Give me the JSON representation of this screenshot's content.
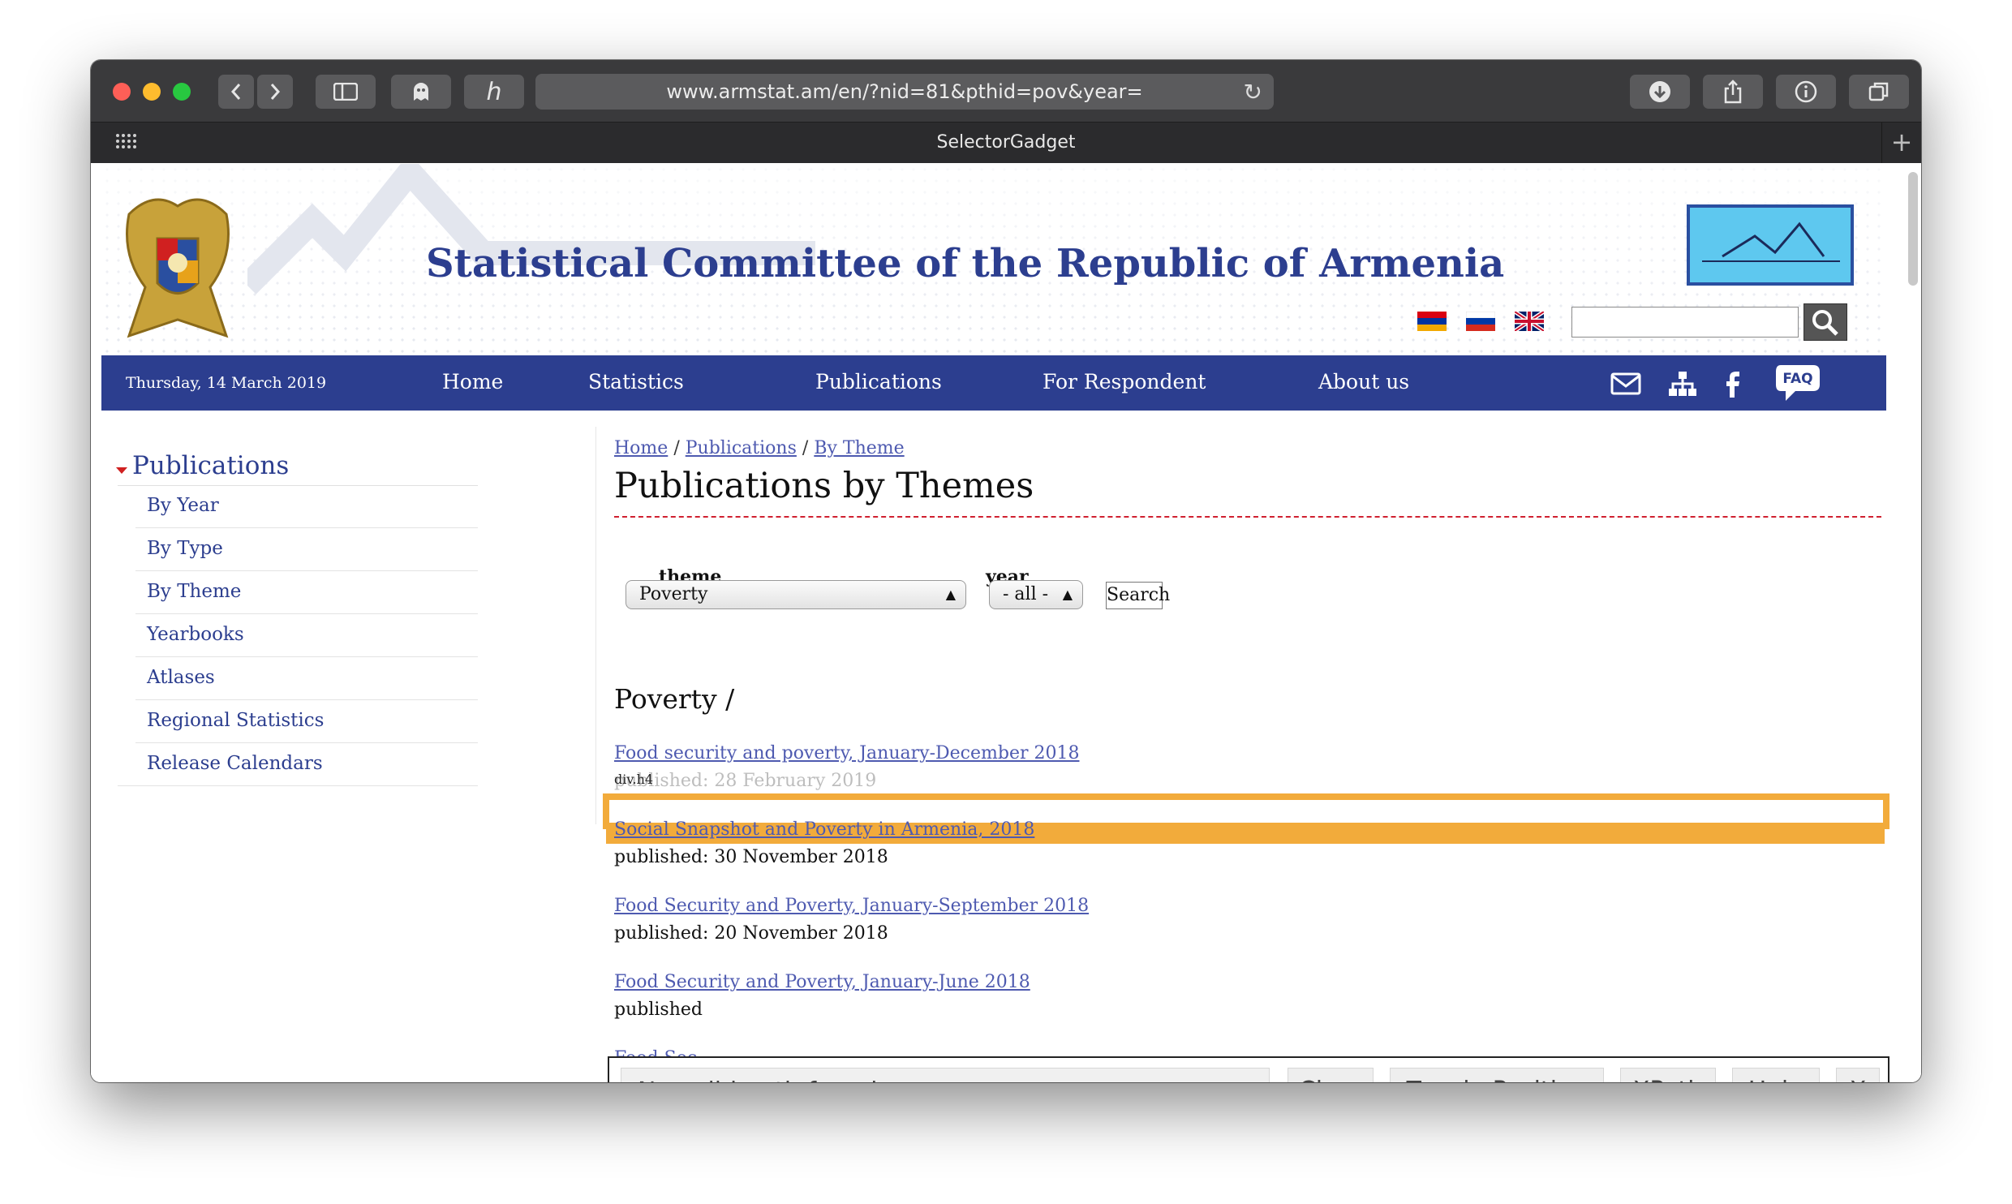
{
  "browser": {
    "url": "www.armstat.am/en/?nid=81&pthid=pov&year=",
    "tab_title": "SelectorGadget"
  },
  "site": {
    "title": "Statistical Committee of the Republic of Armenia",
    "nav": {
      "date": "Thursday, 14 March 2019",
      "items": [
        "Home",
        "Statistics",
        "Publications",
        "For Respondent",
        "About us"
      ],
      "faq": "FAQ"
    },
    "sidebar": {
      "heading": "Publications",
      "items": [
        "By Year",
        "By Type",
        "By Theme",
        "Yearbooks",
        "Atlases",
        "Regional Statistics",
        "Release Calendars"
      ]
    },
    "breadcrumb": {
      "items": [
        "Home",
        "Publications",
        "By Theme"
      ],
      "separator": "/"
    },
    "page_title": "Publications by Themes",
    "filters": {
      "theme_label": "theme",
      "theme_value": "Poverty",
      "year_label": "year",
      "year_value": "- all -",
      "search_label": "Search"
    },
    "section_title": "Poverty /",
    "publications": [
      {
        "title": "Food security and poverty, January-December 2018",
        "date": "published: 28 February 2019"
      },
      {
        "title": "Social Snapshot and Poverty in Armenia, 2018",
        "date": "published: 30 November 2018"
      },
      {
        "title": "Food Security and Poverty, January-September 2018",
        "date": "published: 20 November 2018"
      },
      {
        "title": "Food Security and Poverty, January-June 2018",
        "date": "published"
      },
      {
        "title": "Food Sec",
        "date": ""
      }
    ],
    "highlight_label": "div.h4"
  },
  "selector_gadget": {
    "status": "No valid path found.",
    "buttons": [
      "Clear",
      "Toggle Position",
      "XPath",
      "Help",
      "X"
    ]
  },
  "colors": {
    "brand_blue": "#2c3e8f",
    "highlight": "#f2ab3b",
    "link": "#4e5ab0"
  }
}
